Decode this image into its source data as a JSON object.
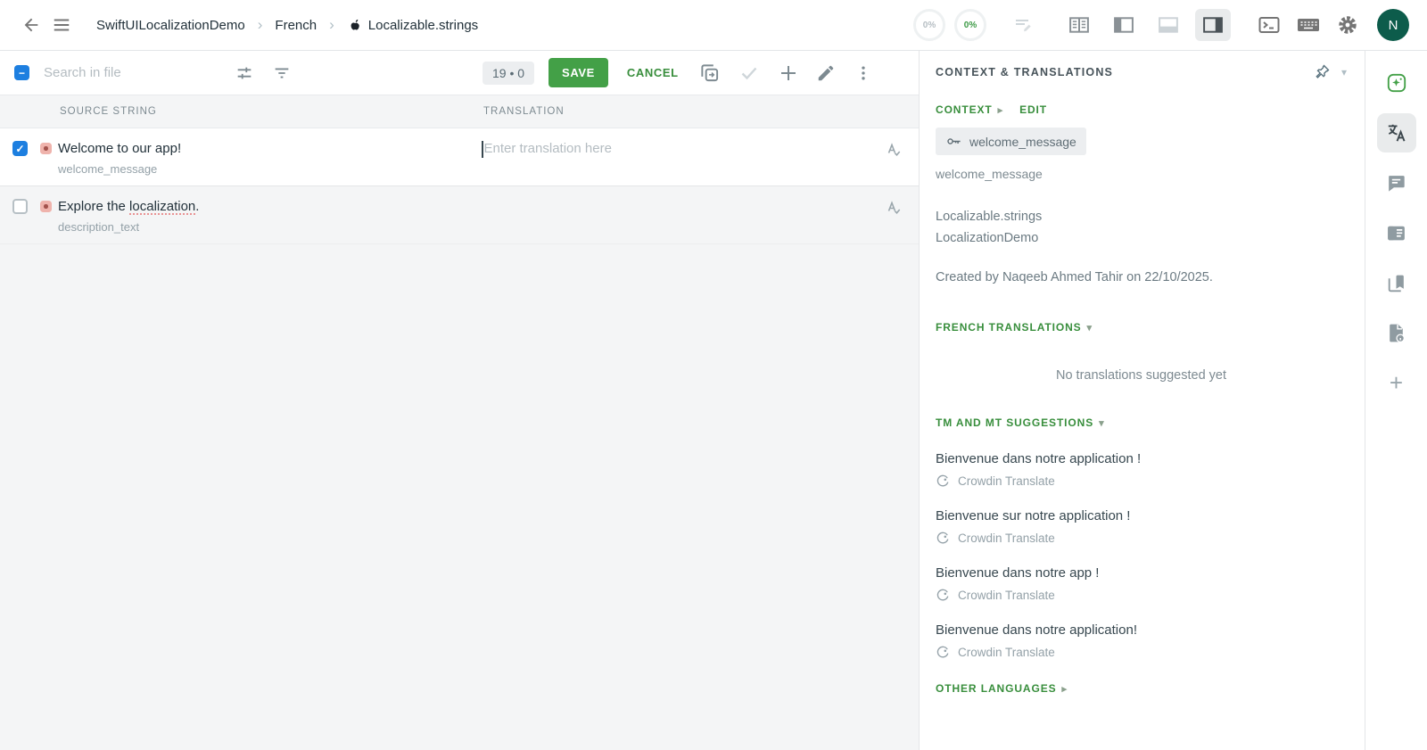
{
  "topbar": {
    "breadcrumb": {
      "project": "SwiftUILocalizationDemo",
      "language": "French",
      "file": "Localizable.strings"
    },
    "progress": {
      "left": "0%",
      "right": "0%"
    },
    "avatar_initial": "N"
  },
  "toolbar": {
    "search_placeholder": "Search in file",
    "counter": "19 • 0",
    "save_label": "SAVE",
    "cancel_label": "CANCEL"
  },
  "grid": {
    "headers": {
      "source": "SOURCE STRING",
      "translation": "TRANSLATION"
    },
    "rows": [
      {
        "text": "Welcome to our app!",
        "key": "welcome_message",
        "translation_placeholder": "Enter translation here",
        "checked": true
      },
      {
        "text_before": "Explore the ",
        "text_underlined": "localization",
        "text_after": ".",
        "key": "description_text",
        "checked": false
      }
    ]
  },
  "panel": {
    "title": "CONTEXT & TRANSLATIONS",
    "context_label": "CONTEXT",
    "edit_label": "EDIT",
    "key_chip": "welcome_message",
    "key_plain": "welcome_message",
    "file_name": "Localizable.strings",
    "project_name": "LocalizationDemo",
    "created_line": "Created by Naqeeb Ahmed Tahir on 22/10/2025.",
    "french_header": "FRENCH TRANSLATIONS",
    "no_translations": "No translations suggested yet",
    "tm_header": "TM AND MT SUGGESTIONS",
    "suggestions": [
      {
        "text": "Bienvenue dans notre application !",
        "source": "Crowdin Translate"
      },
      {
        "text": "Bienvenue sur notre application !",
        "source": "Crowdin Translate"
      },
      {
        "text": "Bienvenue dans notre app !",
        "source": "Crowdin Translate"
      },
      {
        "text": "Bienvenue dans notre application!",
        "source": "Crowdin Translate"
      }
    ],
    "other_languages_header": "OTHER LANGUAGES"
  },
  "glyphs": {
    "breadcrumb_sep": "›",
    "caret_down": "▾",
    "caret_right": "▸",
    "check": "✓",
    "minus": "−",
    "plus": "+"
  },
  "colors": {
    "accent_green": "#43a047",
    "green_text": "#388e3c",
    "checkbox_blue": "#1d7fe0",
    "status_red": "#efb3ac",
    "avatar_bg": "#0d5c4b"
  }
}
